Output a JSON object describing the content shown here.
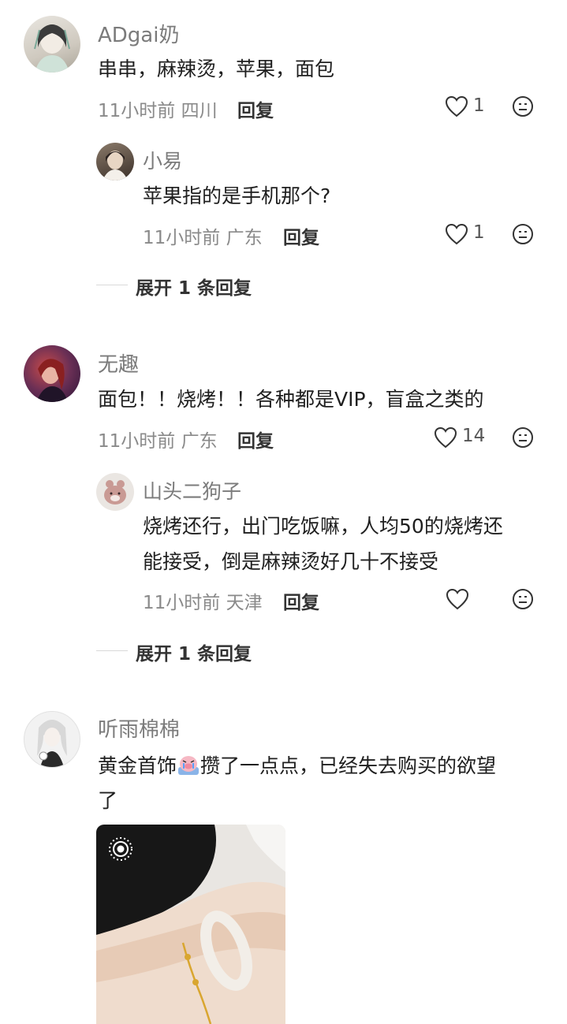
{
  "comments": [
    {
      "user": "ADgai奶",
      "text": "串串，麻辣烫，苹果，面包",
      "time": "11小时前",
      "location": "四川",
      "reply_label": "回复",
      "likes": "1",
      "replies": [
        {
          "user": "小易",
          "text": "苹果指的是手机那个?",
          "time": "11小时前",
          "location": "广东",
          "reply_label": "回复",
          "likes": "1"
        }
      ],
      "expand_label": "展开 1 条回复"
    },
    {
      "user": "无趣",
      "text": "面包！！烧烤！！各种都是VIP，盲盒之类的",
      "time": "11小时前",
      "location": "广东",
      "reply_label": "回复",
      "likes": "14",
      "replies": [
        {
          "user": "山头二狗子",
          "text_line1": "烧烤还行，出门吃饭嘛，人均50的烧烤还",
          "text_line2": "能接受，倒是麻辣烫好几十不接受",
          "time": "11小时前",
          "location": "天津",
          "reply_label": "回复",
          "likes": ""
        }
      ],
      "expand_label": "展开 1 条回复"
    },
    {
      "user": "听雨棉棉",
      "text_before_emoji": "黄金首饰",
      "text_after_emoji": "攒了一点点，已经失去购买的欲望",
      "text_line2": "了",
      "emoji_name": "crying-pig-emoji"
    }
  ],
  "colors": {
    "text": "#1f1f1f",
    "meta": "#8a8a8a",
    "username": "#7b7b7b",
    "icon": "#333333"
  },
  "icons": [
    "heart-icon",
    "emoji-face-icon",
    "live-photo-icon"
  ]
}
